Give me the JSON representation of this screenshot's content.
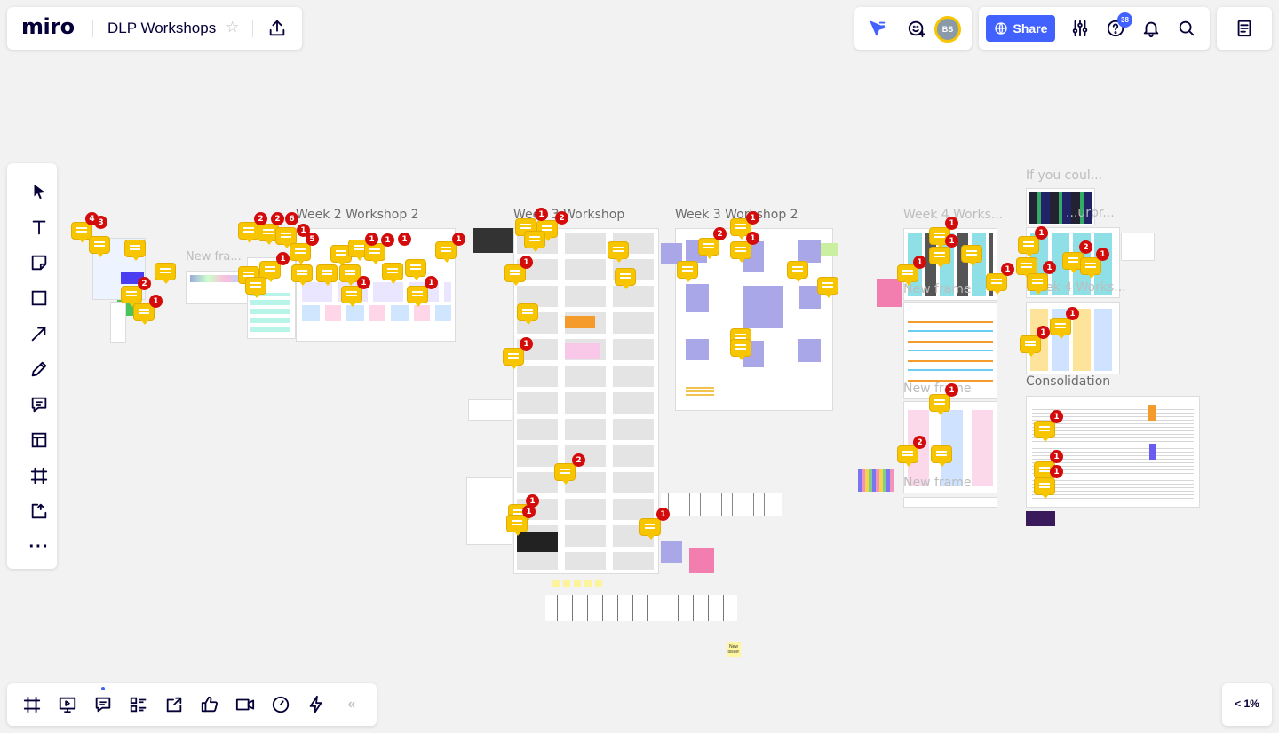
{
  "app": {
    "logo": "miro",
    "board_title": "DLP Workshops"
  },
  "header_right": {
    "avatar_initials": "BS",
    "share_label": "Share",
    "help_badge": "38"
  },
  "zoom": {
    "label": "< 1%"
  },
  "frames": {
    "w2w2": "Week 2 Workshop 2",
    "wxw": "Week 3 Workshop",
    "w3w2": "Week 3 Workshop 2",
    "w4": "Week 4 Works...",
    "new_frame_left": "New fra...",
    "if_you": "If you coul...",
    "surpr": "...urpr...",
    "week4b": "...eek 4 Works...",
    "new_frame_1": "New frame",
    "new_frame_2": "New frame",
    "new_frame_3": "New frame",
    "consolidation": "Consolidation",
    "note_small": "New issue!"
  },
  "badges": {
    "b1": "4",
    "b2": "3",
    "b3": "2",
    "b4": "2",
    "b5": "2",
    "b6": "1",
    "b7": "3",
    "b8": "1",
    "b9": "6",
    "b10": "1",
    "b11": "5",
    "b12": "1",
    "b13": "1",
    "b14": "1",
    "b15": "1",
    "b16": "1",
    "b17": "1",
    "b18": "1",
    "b19": "2",
    "b20": "2",
    "b21": "1",
    "b22": "1",
    "b23": "1",
    "b24": "2",
    "b25": "1",
    "b26": "1",
    "b27": "1",
    "b28": "1",
    "b29": "1",
    "b30": "2",
    "b31": "1",
    "b32": "1",
    "b33": "1",
    "b34": "2",
    "b35": "1",
    "b36": "1",
    "b37": "1",
    "b38": "1",
    "b39": "1",
    "b40": "1",
    "b41": "1",
    "b42": "2",
    "b43": "1",
    "b44": "1",
    "b45": "1",
    "b46": "1"
  },
  "colors": {
    "accent": "#4262ff",
    "comment": "#f7c600",
    "badge": "#d40b0b"
  }
}
